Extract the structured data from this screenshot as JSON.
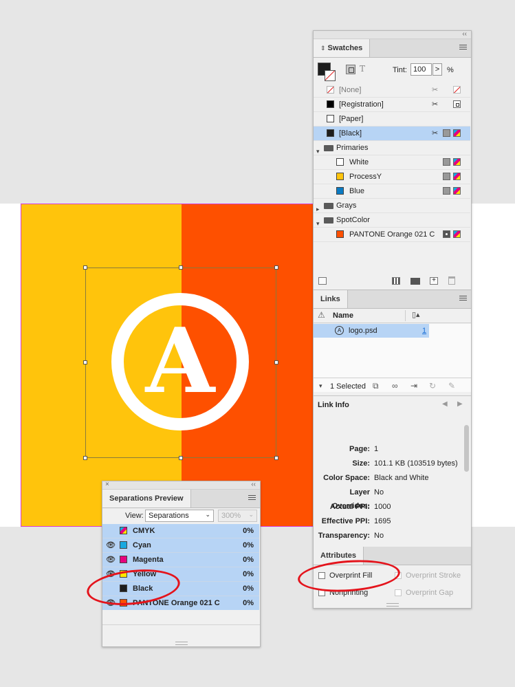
{
  "swatches_panel": {
    "tab": "Swatches",
    "tint_label": "Tint:",
    "tint_value": "100",
    "tint_unit": "%",
    "tint_arrow": ">",
    "rows": [
      {
        "name": "[None]"
      },
      {
        "name": "[Registration]"
      },
      {
        "name": "[Paper]"
      },
      {
        "name": "[Black]"
      },
      {
        "name": "Primaries"
      },
      {
        "name": "White"
      },
      {
        "name": "ProcessY"
      },
      {
        "name": "Blue"
      },
      {
        "name": "Grays"
      },
      {
        "name": "SpotColor"
      },
      {
        "name": "PANTONE Orange 021 C"
      }
    ],
    "colors": {
      "black": "#1e1e1e",
      "white": "#ffffff",
      "yellow": "#ffc40c",
      "blue": "#0a7ac2",
      "orange": "#fe5000",
      "selected_row": "#b7d4f5"
    }
  },
  "links_panel": {
    "tab": "Links",
    "col_name": "Name",
    "items": [
      {
        "name": "logo.psd",
        "page": "1"
      }
    ],
    "selected_text": "1 Selected"
  },
  "link_info": {
    "title": "Link Info",
    "rows": [
      {
        "key": "Page:",
        "value": "1"
      },
      {
        "key": "Size:",
        "value": "101.1 KB (103519 bytes)"
      },
      {
        "key": "Color Space:",
        "value": "Black and White"
      },
      {
        "key": "Layer Overrides:",
        "value": "No"
      },
      {
        "key": "Actual PPI:",
        "value": "1000"
      },
      {
        "key": "Effective PPI:",
        "value": "1695"
      },
      {
        "key": "Transparency:",
        "value": "No"
      }
    ]
  },
  "attributes_panel": {
    "tab": "Attributes",
    "overprint_fill": "Overprint Fill",
    "nonprinting": "Nonprinting",
    "overprint_stroke": "Overprint Stroke",
    "overprint_gap": "Overprint Gap"
  },
  "separations_panel": {
    "tab": "Separations Preview",
    "view_label": "View:",
    "view_value": "Separations",
    "zoom_value": "300%",
    "rows": [
      {
        "name": "CMYK",
        "value": "0%",
        "color": "#2a6fd6"
      },
      {
        "name": "Cyan",
        "value": "0%",
        "color": "#17a8e0"
      },
      {
        "name": "Magenta",
        "value": "0%",
        "color": "#e6007e"
      },
      {
        "name": "Yellow",
        "value": "0%",
        "color": "#ffe600"
      },
      {
        "name": "Black",
        "value": "0%",
        "color": "#1e1e1e"
      },
      {
        "name": "PANTONE Orange 021 C",
        "value": "0%",
        "color": "#fe5000"
      }
    ]
  },
  "artwork": {
    "logo_letter": "A",
    "left_color": "#ffc40c",
    "right_color": "#fe5000"
  }
}
